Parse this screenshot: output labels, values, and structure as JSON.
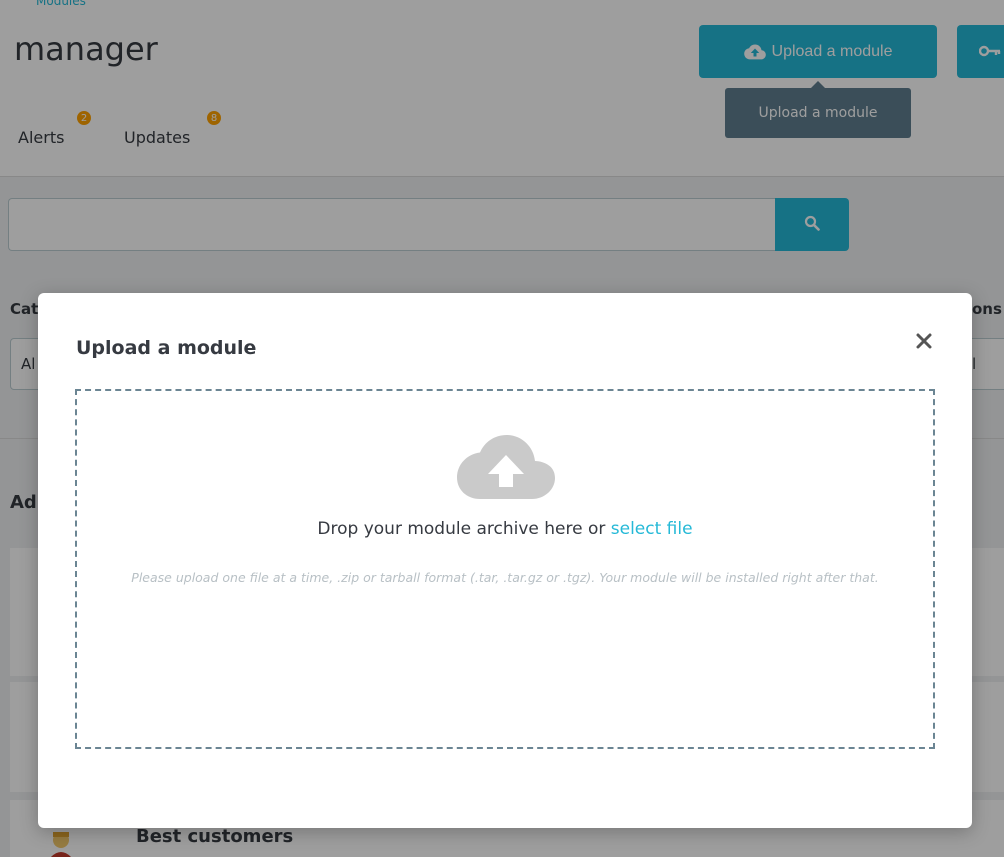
{
  "breadcrumb": "Modules",
  "header": {
    "title": "manager",
    "upload_button": "Upload a module",
    "tooltip": "Upload a module"
  },
  "tabs": [
    {
      "label": "Alerts",
      "badge": "2"
    },
    {
      "label": "Updates",
      "badge": "8"
    }
  ],
  "search": {
    "value": "",
    "placeholder": ""
  },
  "background": {
    "category_label": "Cat",
    "right_label": "ons",
    "left_select": "Al",
    "right_select": "l",
    "section_title": "Ad",
    "best_customers": "Best customers"
  },
  "modal": {
    "title": "Upload a module",
    "drop_text": "Drop your module archive here or",
    "select_file": "select file",
    "help_text": "Please upload one file at a time, .zip or tarball format (.tar, .tar.gz or .tgz). Your module will be installed right after that."
  },
  "colors": {
    "accent": "#25b9d7",
    "badge": "#ffa200",
    "tooltip_bg": "#5f7f90",
    "dropzone_border": "#6b8593"
  }
}
